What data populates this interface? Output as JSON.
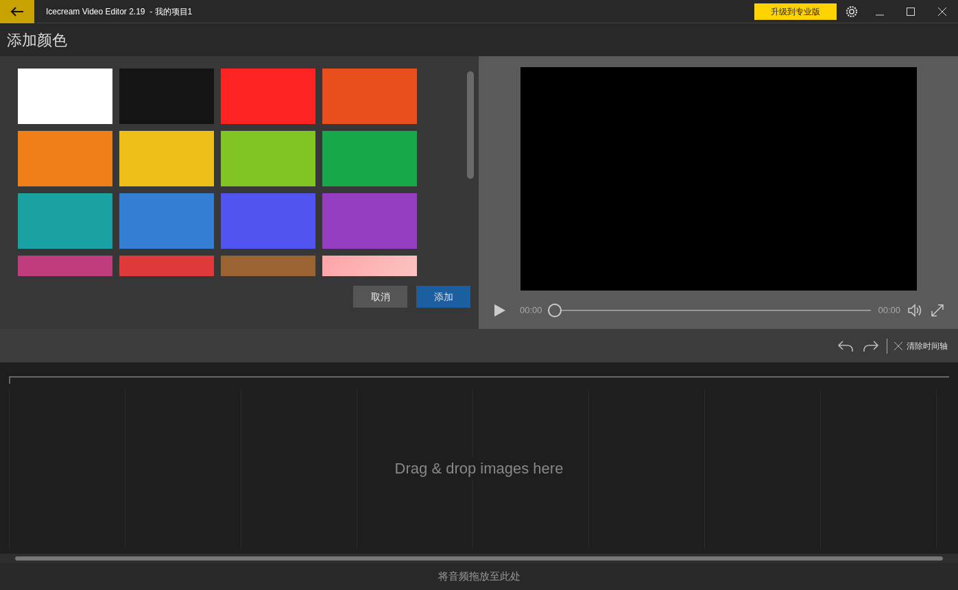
{
  "window": {
    "title": "Icecream Video Editor 2.19  - 我的项目1",
    "upgrade_button": "升级到专业版"
  },
  "dialog": {
    "title": "添加颜色",
    "swatches": [
      {
        "kind": "solid",
        "color": "#ffffff"
      },
      {
        "kind": "solid",
        "color": "#141414"
      },
      {
        "kind": "solid",
        "color": "#fe2323"
      },
      {
        "kind": "solid",
        "color": "#e94e1d"
      },
      {
        "kind": "solid",
        "color": "#ef8019"
      },
      {
        "kind": "solid",
        "color": "#efbf19"
      },
      {
        "kind": "solid",
        "color": "#80c523"
      },
      {
        "kind": "solid",
        "color": "#18a84a"
      },
      {
        "kind": "solid",
        "color": "#1aa2a2"
      },
      {
        "kind": "solid",
        "color": "#347fd4"
      },
      {
        "kind": "solid",
        "color": "#5254ef"
      },
      {
        "kind": "solid",
        "color": "#953ec1"
      },
      {
        "kind": "solid",
        "color": "#bf3c7d"
      },
      {
        "kind": "solid",
        "color": "#df3a3a"
      },
      {
        "kind": "solid",
        "color": "#996332"
      },
      {
        "kind": "gradient",
        "color": "#ffa3a8"
      }
    ],
    "buttons": [
      {
        "label": "取消",
        "kind": "secondary"
      },
      {
        "label": "添加",
        "kind": "primary"
      }
    ]
  },
  "player": {
    "current_time": "00:00",
    "duration": "00:00",
    "level": 0
  },
  "toolbar": {
    "clear_label": "清除时间轴"
  },
  "timeline": {
    "placeholder": "Drag & drop images here"
  },
  "audio_track": {
    "placeholder": "将音频拖放至此处"
  }
}
